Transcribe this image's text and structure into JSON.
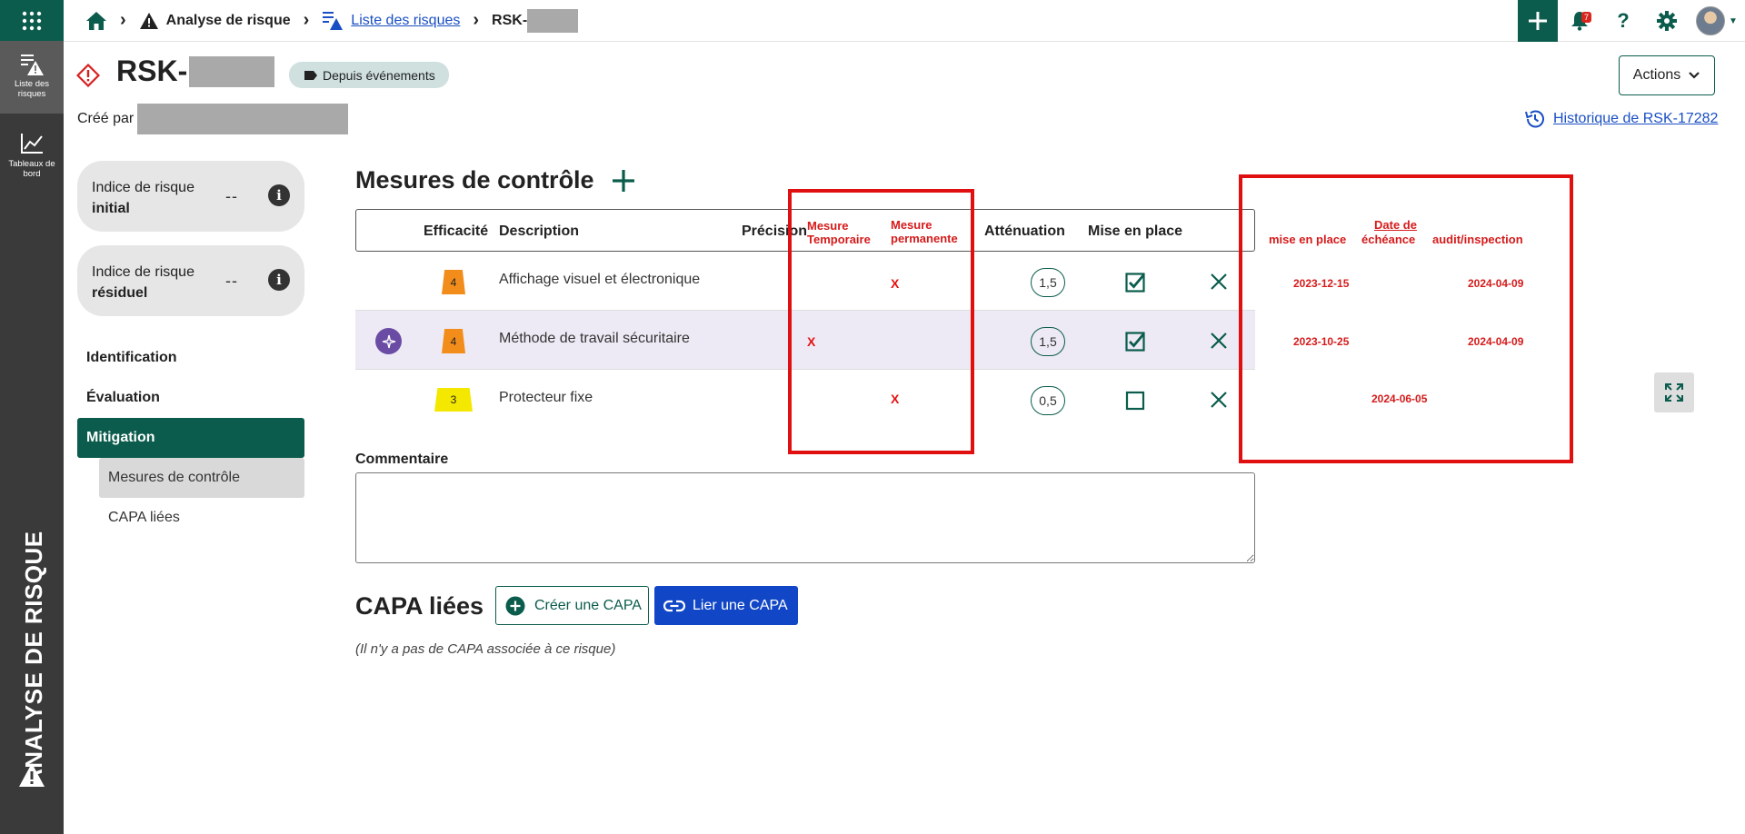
{
  "rail": {
    "items": [
      {
        "label": "Liste des risques"
      },
      {
        "label": "Tableaux de bord"
      }
    ],
    "vertical_title": "ANALYSE DE RISQUE"
  },
  "breadcrumb": {
    "module": "Analyse de risque",
    "list": "Liste des risques",
    "current": "RSK-"
  },
  "topbar": {
    "notification_count": "7"
  },
  "header": {
    "title": "RSK-",
    "tag": "Depuis événements",
    "created_by_label": "Créé par",
    "actions_label": "Actions",
    "history_link": "Historique de RSK-17282"
  },
  "risk_cards": [
    {
      "line1": "Indice de risque",
      "line2": "initial",
      "value": "--"
    },
    {
      "line1": "Indice de risque",
      "line2": "résiduel",
      "value": "--"
    }
  ],
  "nav": {
    "identification": "Identification",
    "evaluation": "Évaluation",
    "mitigation": "Mitigation",
    "sub_controls": "Mesures de contrôle",
    "sub_capa": "CAPA liées"
  },
  "controls": {
    "title": "Mesures de contrôle",
    "headers": {
      "efficacite": "Efficacité",
      "description": "Description",
      "precision": "Précision",
      "attenuation": "Atténuation",
      "mise_en_place": "Mise en place"
    },
    "annot_headers": {
      "temp_1": "Mesure",
      "temp_2": "Temporaire",
      "perm_1": "Mesure",
      "perm_2": "permanente",
      "date_de": "Date de",
      "mise": "mise en place",
      "echeance": "échéance",
      "audit": "audit/inspection"
    },
    "rows": [
      {
        "efficacite": "4",
        "description": "Affichage visuel et électronique",
        "attenuation": "1,5",
        "mise_en_place": true,
        "temp": "",
        "perm": "X",
        "date_mise": "2023-12-15",
        "date_echeance": "",
        "date_audit": "2024-04-09"
      },
      {
        "efficacite": "4",
        "description": "Méthode de travail sécuritaire",
        "attenuation": "1,5",
        "mise_en_place": true,
        "temp": "X",
        "perm": "",
        "date_mise": "2023-10-25",
        "date_echeance": "",
        "date_audit": "2024-04-09"
      },
      {
        "efficacite": "3",
        "description": "Protecteur fixe",
        "attenuation": "0,5",
        "mise_en_place": false,
        "temp": "",
        "perm": "X",
        "date_mise": "",
        "date_echeance": "2024-06-05",
        "date_audit": ""
      }
    ]
  },
  "comment": {
    "label": "Commentaire",
    "value": ""
  },
  "capa": {
    "title": "CAPA liées",
    "create_label": "Créer une CAPA",
    "link_label": "Lier une CAPA",
    "empty_text": "(Il n'y a pas de CAPA associée à ce risque)"
  },
  "colors": {
    "brand": "#0b5c4c",
    "primary_button": "#1147c6",
    "annotation": "#e01010",
    "orange": "#f28c1b",
    "yellow": "#f5e800"
  }
}
